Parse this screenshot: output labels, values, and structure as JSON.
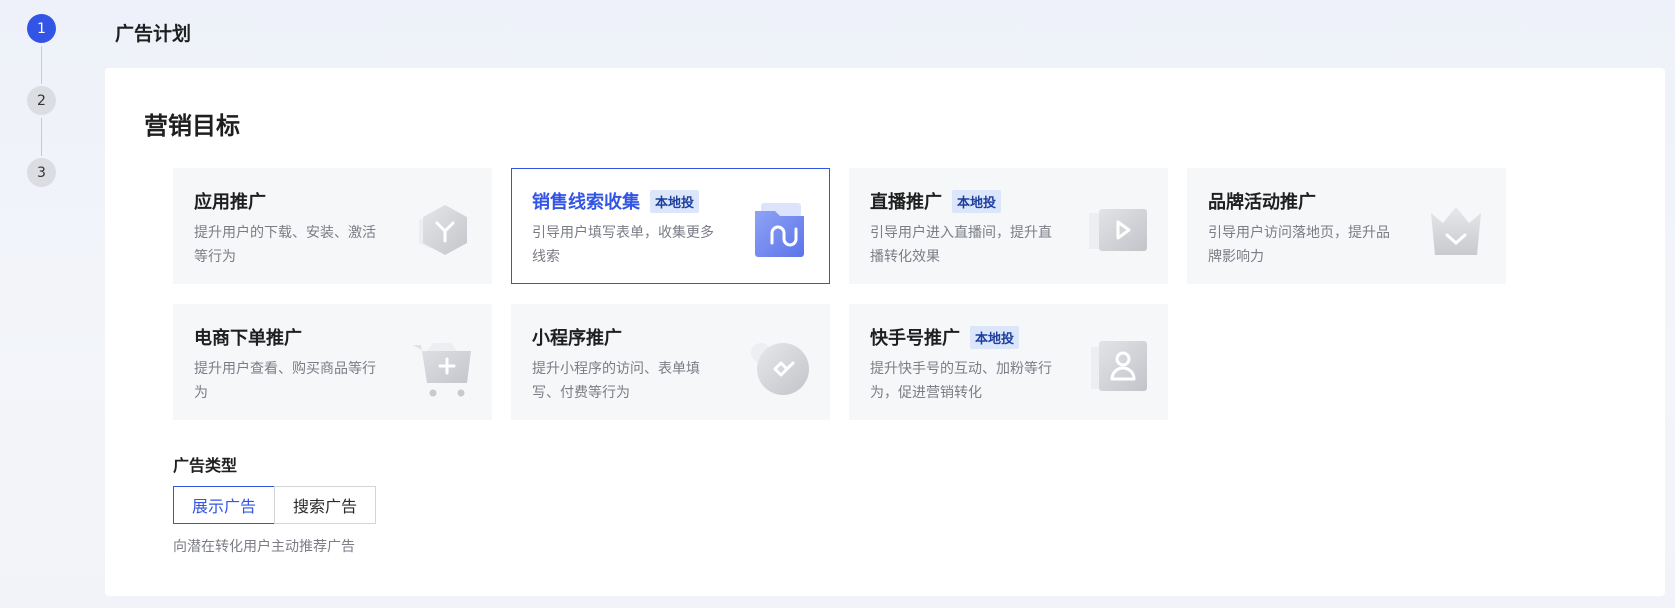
{
  "stepper": {
    "steps": [
      "1",
      "2",
      "3"
    ],
    "active": 1
  },
  "page_title": "广告计划",
  "marketing": {
    "title": "营销目标",
    "cards": [
      {
        "title": "应用推广",
        "tag": "",
        "desc": "提升用户的下载、安装、激活等行为",
        "icon": "hexagon-app-icon",
        "selected": false
      },
      {
        "title": "销售线索收集",
        "tag": "本地投",
        "desc": "引导用户填写表单，收集更多线索",
        "icon": "folder-lead-icon",
        "selected": true
      },
      {
        "title": "直播推广",
        "tag": "本地投",
        "desc": "引导用户进入直播间，提升直播转化效果",
        "icon": "play-live-icon",
        "selected": false
      },
      {
        "title": "品牌活动推广",
        "tag": "",
        "desc": "引导用户访问落地页，提升品牌影响力",
        "icon": "crown-brand-icon",
        "selected": false
      },
      {
        "title": "电商下单推广",
        "tag": "",
        "desc": "提升用户查看、购买商品等行为",
        "icon": "cart-icon",
        "selected": false
      },
      {
        "title": "小程序推广",
        "tag": "",
        "desc": "提升小程序的访问、表单填写、付费等行为",
        "icon": "mini-program-icon",
        "selected": false
      },
      {
        "title": "快手号推广",
        "tag": "本地投",
        "desc": "提升快手号的互动、加粉等行为，促进营销转化",
        "icon": "profile-icon",
        "selected": false
      }
    ]
  },
  "ad_type": {
    "label": "广告类型",
    "options": [
      "展示广告",
      "搜索广告"
    ],
    "selected": 0,
    "desc": "向潜在转化用户主动推荐广告"
  },
  "colors": {
    "accent": "#3355e6",
    "tag_bg": "#dbe6fb",
    "card_bg": "#f6f7f9"
  }
}
